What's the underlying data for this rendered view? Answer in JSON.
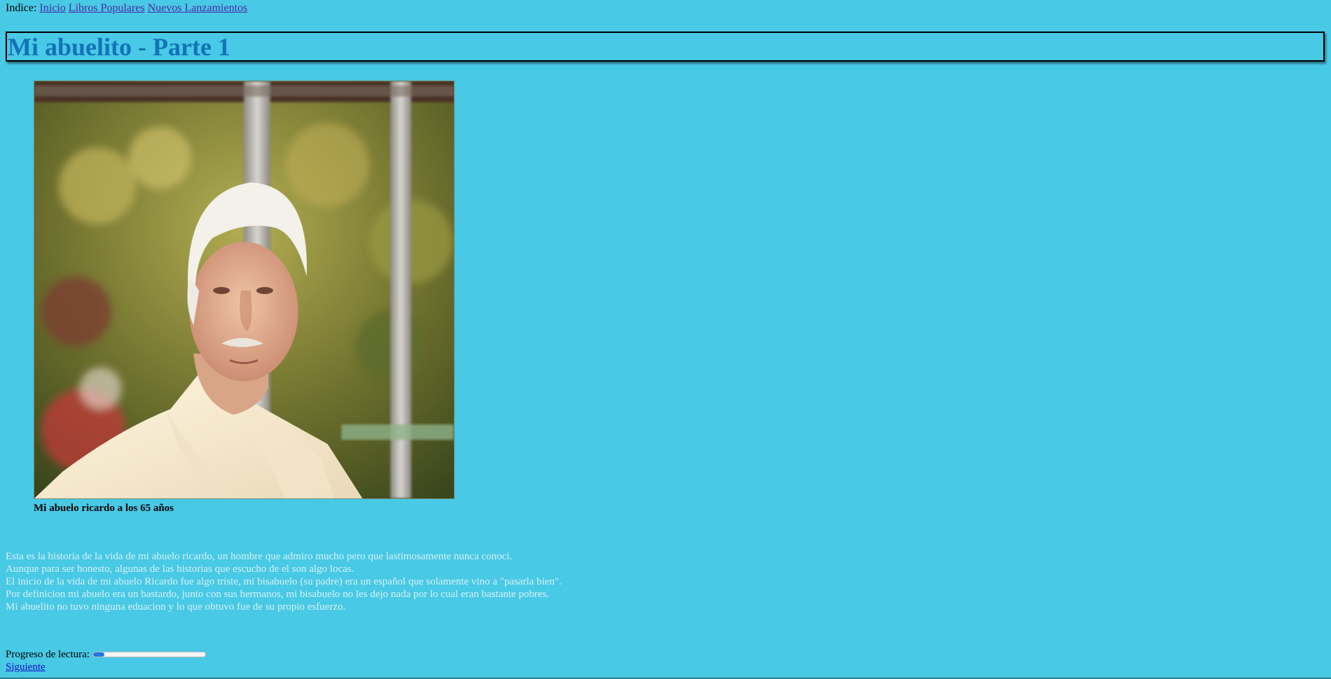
{
  "nav": {
    "prefix": "Indice:",
    "links": [
      "Inicio",
      "Libros Populares",
      "Nuevos Lanzamientos"
    ]
  },
  "page_title": "Mi abuelito - Parte 1",
  "photo": {
    "caption": "Mi abuelo ricardo a los 65 años"
  },
  "story": {
    "lines": [
      "Esta es la historia de la vida de mi abuelo ricardo, un hombre que admiro mucho pero que lastimosamente nunca conoci.",
      "Aunque para ser honesto, algunas de las historias que escucho de el son algo locas.",
      "El inicio de la vida de mi abuelo Ricardo fue algo triste, mi bisabuelo (su padre) era un español que solamente vino a \"pasarla bien\".",
      "Por definicion mi abuelo era un bastardo, junto con sus hermanos, mi bisabuelo no les dejo nada por lo cual eran bastante pobres.",
      "Mi abuelito no tuvo ninguna eduacion y lo que obtuvo fue de su propio esfuerzo."
    ]
  },
  "progress": {
    "label": "Progreso de lectura:",
    "value": 0.1
  },
  "next_label": "Siguiente",
  "colors": {
    "background": "#48c9e5",
    "title": "#1372b8",
    "story_text": "#d7f1f7",
    "progress_fill": "#1f74e8"
  }
}
